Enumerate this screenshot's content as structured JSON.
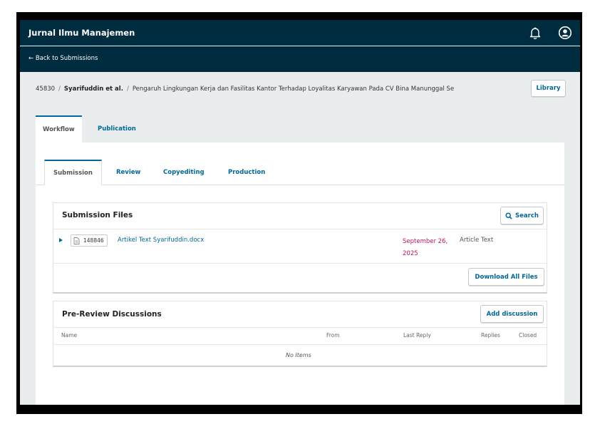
{
  "header": {
    "site_title": "Jurnal Ilmu Manajemen"
  },
  "icons": {
    "notifications": "bell-icon",
    "user": "user-circle-icon",
    "file": "file-icon"
  },
  "back": {
    "label": "← Back to Submissions"
  },
  "breadcrumb": {
    "id": "45830",
    "author": "Syarifuddin et al.",
    "title": "Pengaruh Lingkungan Kerja dan Fasilitas Kantor Terhadap Loyalitas Karyawan Pada CV Bina Manunggal Se"
  },
  "library_button": "Library",
  "outer_tabs": [
    {
      "label": "Workflow",
      "active": true
    },
    {
      "label": "Publication",
      "active": false
    }
  ],
  "inner_tabs": [
    {
      "label": "Submission",
      "active": true
    },
    {
      "label": "Review",
      "active": false
    },
    {
      "label": "Copyediting",
      "active": false
    },
    {
      "label": "Production",
      "active": false
    }
  ],
  "submission_files": {
    "title": "Submission Files",
    "search_button": "Search",
    "files": [
      {
        "id": "148846",
        "name": "Artikel Text Syarifuddin.docx",
        "date": "September 26, 2025",
        "type": "Article Text"
      }
    ],
    "download_button": "Download All Files"
  },
  "discussions": {
    "title": "Pre-Review Discussions",
    "add_button": "Add discussion",
    "columns": [
      "Name",
      "From",
      "Last Reply",
      "Replies",
      "Closed"
    ],
    "empty_text": "No Items"
  },
  "colors": {
    "header_bg": "#002c40",
    "accent": "#006798",
    "date": "#c0145f",
    "page_bg": "#eaedee"
  }
}
